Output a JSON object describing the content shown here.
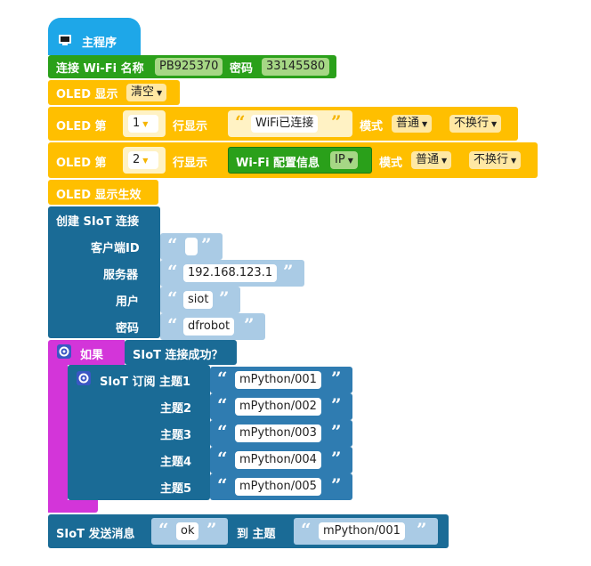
{
  "colors": {
    "event_blue": "#1ea7e8",
    "wifi_green": "#2aa01a",
    "oled_yellow": "#ffbf00",
    "siot_blue": "#1a6b96",
    "if_magenta": "#d335d9",
    "slot_light": "#aacbe5",
    "value_mid": "#2f7cb1"
  },
  "main": {
    "hat_label": "主程序",
    "hat_icon": "monitor-icon"
  },
  "wifi": {
    "label": "连接 Wi-Fi 名称",
    "ssid": "PB925370",
    "pwd_label": "密码",
    "pwd": "33145580"
  },
  "oled_clear": {
    "label": "OLED 显示",
    "option": "清空"
  },
  "oled_line1": {
    "label": "OLED 第",
    "line": "1",
    "row_label": "行显示",
    "text": "WiFi已连接",
    "mode_label": "模式",
    "mode": "普通",
    "wrap": "不换行"
  },
  "oled_line2": {
    "label": "OLED 第",
    "line": "2",
    "row_label": "行显示",
    "info_label": "Wi-Fi 配置信息",
    "info_option": "IP",
    "mode_label": "模式",
    "mode": "普通",
    "wrap": "不换行"
  },
  "oled_show": {
    "label": "OLED 显示生效"
  },
  "siot_connect": {
    "label": "创建 SIoT 连接",
    "client_label": "客户端ID",
    "client_value": "",
    "server_label": "服务器",
    "server_value": "192.168.123.1",
    "user_label": "用户",
    "user_value": "siot",
    "pwd_label": "密码",
    "pwd_value": "dfrobot"
  },
  "if_block": {
    "label": "如果",
    "condition": "SIoT 连接成功？",
    "gear_icon": "gear-icon"
  },
  "subscribe": {
    "label": "SIoT 订阅 主题1",
    "topic1": "mPython/001",
    "t2_label": "主题2",
    "topic2": "mPython/002",
    "t3_label": "主题3",
    "topic3": "mPython/003",
    "t4_label": "主题4",
    "topic4": "mPython/004",
    "t5_label": "主题5",
    "topic5": "mPython/005",
    "gear_icon": "gear-icon"
  },
  "send": {
    "label": "SIoT 发送消息",
    "message": "ok",
    "to_label": "到 主题",
    "topic": "mPython/001"
  },
  "quote_open": "“",
  "quote_close": "”",
  "dropdown_caret": "▼"
}
